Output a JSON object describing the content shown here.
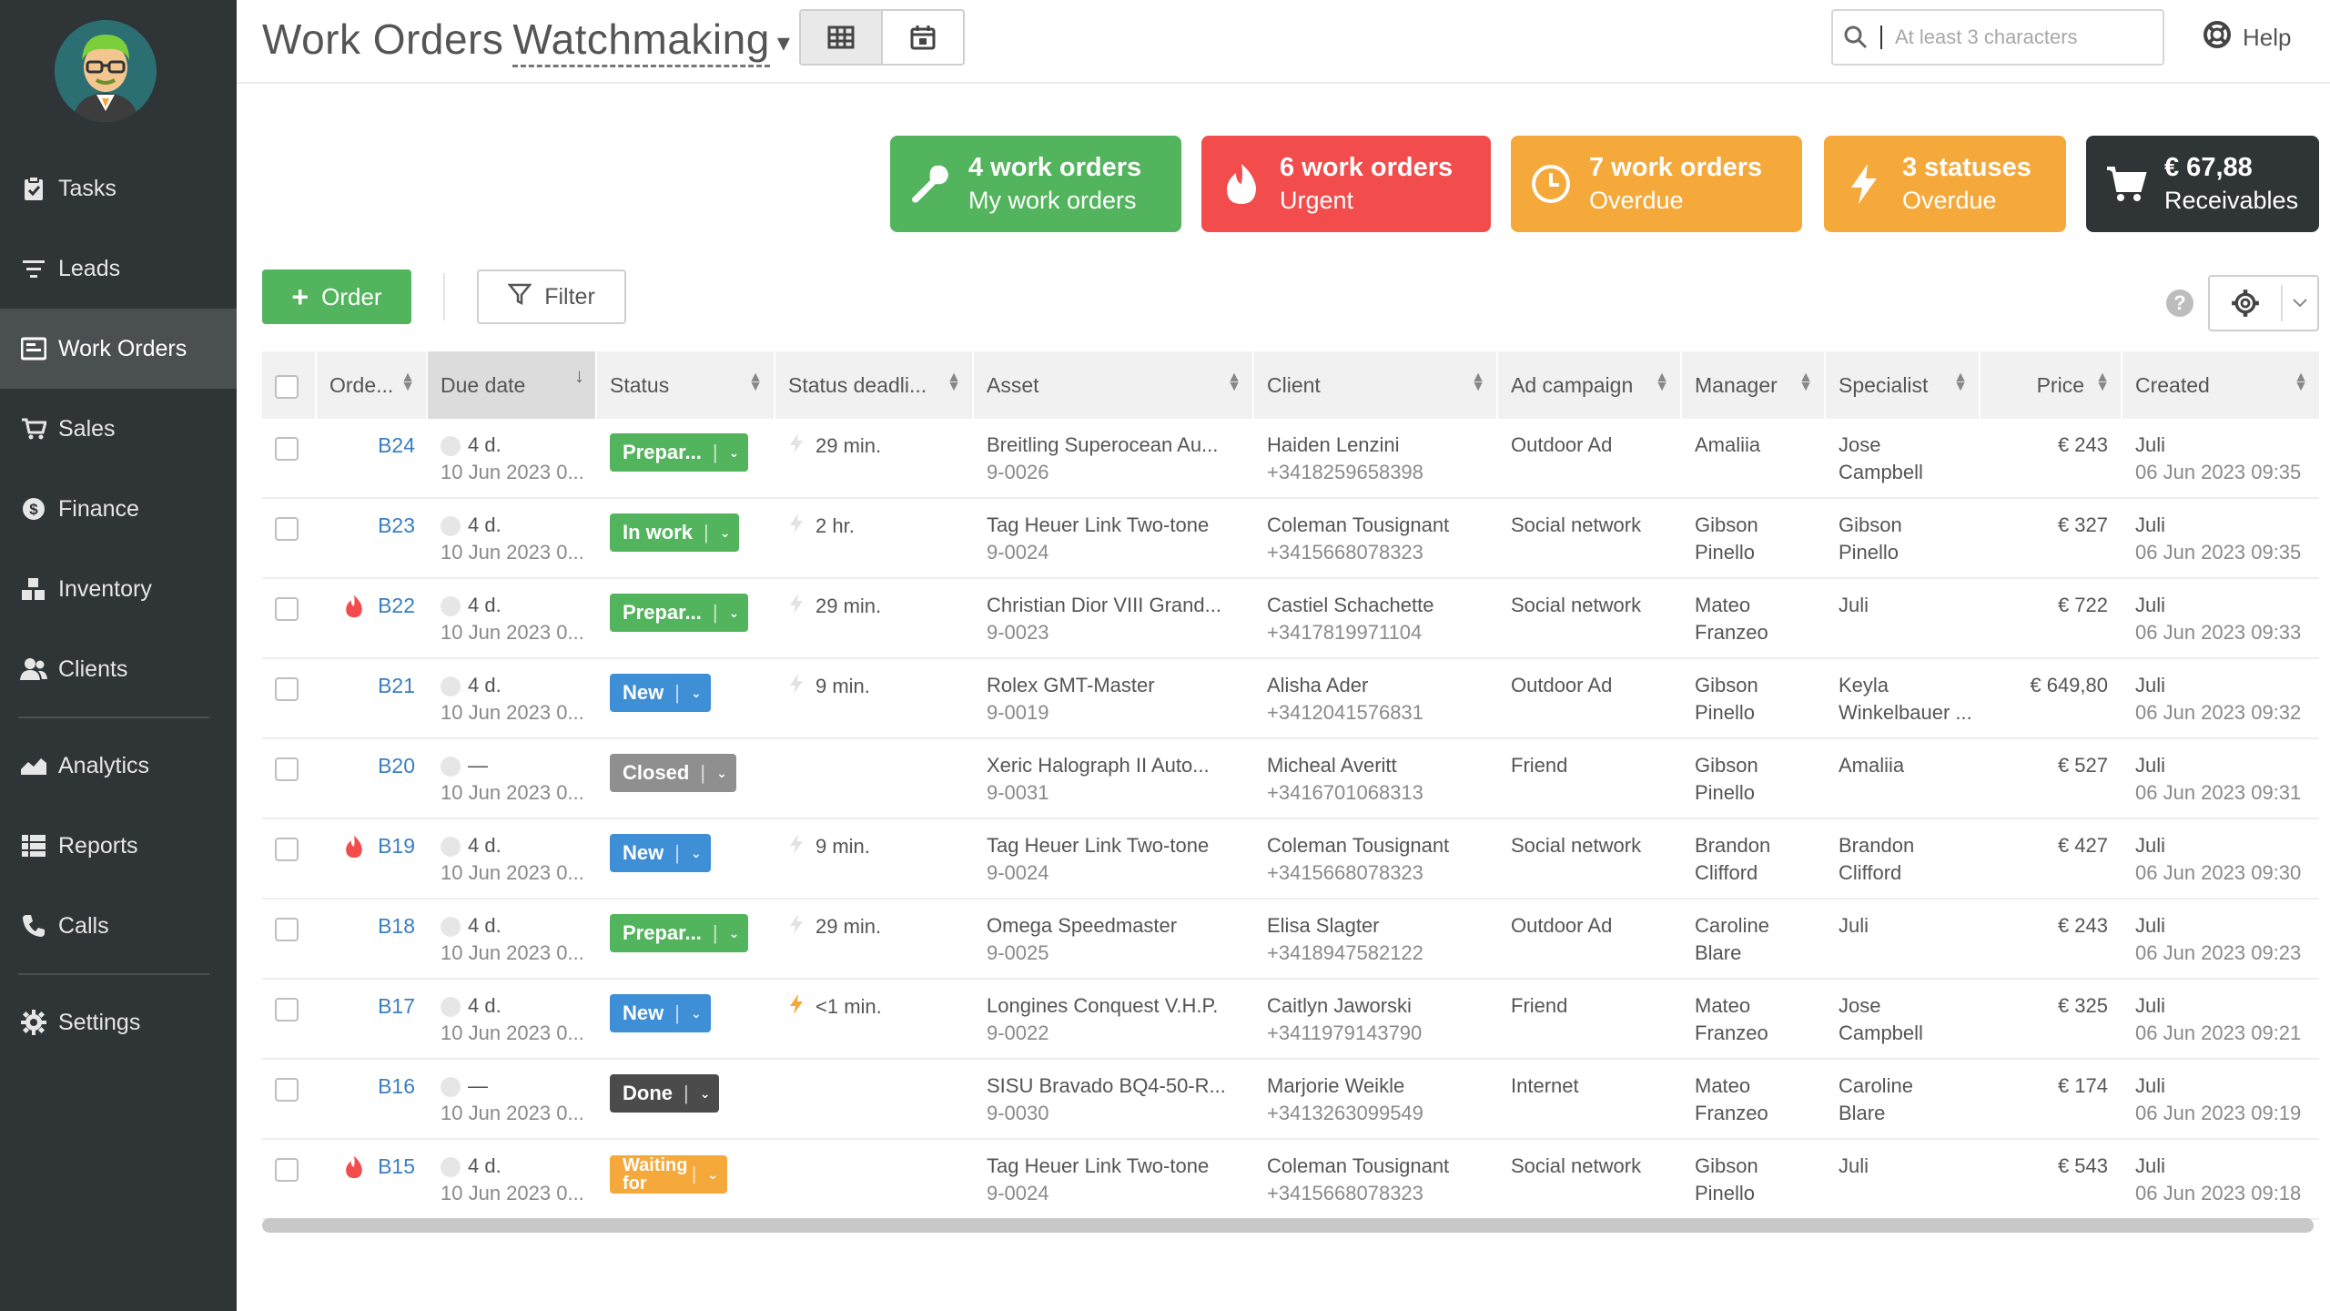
{
  "sidebar": {
    "items": [
      {
        "label": "Tasks",
        "icon": "clipboard-icon"
      },
      {
        "label": "Leads",
        "icon": "funnel-icon"
      },
      {
        "label": "Work Orders",
        "icon": "work-orders-icon",
        "active": true
      },
      {
        "label": "Sales",
        "icon": "cart-icon"
      },
      {
        "label": "Finance",
        "icon": "dollar-icon"
      },
      {
        "label": "Inventory",
        "icon": "boxes-icon"
      },
      {
        "label": "Clients",
        "icon": "users-icon"
      },
      {
        "label": "Analytics",
        "icon": "chart-icon"
      },
      {
        "label": "Reports",
        "icon": "table-icon"
      },
      {
        "label": "Calls",
        "icon": "phone-icon"
      },
      {
        "label": "Settings",
        "icon": "gear-icon"
      }
    ]
  },
  "header": {
    "title": "Work Orders",
    "selector": "Watchmaking",
    "search_placeholder": "At least 3 characters",
    "help_label": "Help"
  },
  "stats": [
    {
      "line1": "4 work orders",
      "line2": "My work orders",
      "color": "#52b45c",
      "icon": "wrench-icon"
    },
    {
      "line1": "6 work orders",
      "line2": "Urgent",
      "color": "#f24c4c",
      "icon": "flame-icon"
    },
    {
      "line1": "7 work orders",
      "line2": "Overdue",
      "color": "#f5a93a",
      "icon": "clock-icon"
    },
    {
      "line1": "3 statuses",
      "line2": "Overdue",
      "color": "#f5a93a",
      "icon": "bolt-icon"
    },
    {
      "line1": "€ 67,88",
      "line2": "Receivables",
      "color": "#2f3437",
      "icon": "cart-icon"
    }
  ],
  "toolbar": {
    "order_label": "Order",
    "filter_label": "Filter"
  },
  "table": {
    "columns": [
      "Orde...",
      "Due date",
      "Status",
      "Status deadli...",
      "Asset",
      "Client",
      "Ad campaign",
      "Manager",
      "Specialist",
      "Price",
      "Created"
    ],
    "rows": [
      {
        "order": "B24",
        "urgent": false,
        "due1": "4 d.",
        "due2": "10 Jun 2023 0...",
        "status": "Prepar...",
        "status_color": "green",
        "deadline": "29 min.",
        "bolt_active": false,
        "asset1": "Breitling Superocean Au...",
        "asset2": "9-0026",
        "client1": "Haiden Lenzini",
        "client2": "+3418259658398",
        "ad": "Outdoor Ad",
        "manager1": "Amaliia",
        "manager2": "",
        "spec1": "Jose",
        "spec2": "Campbell",
        "price": "€ 243",
        "created1": "Juli",
        "created2": "06 Jun 2023 09:35"
      },
      {
        "order": "B23",
        "urgent": false,
        "due1": "4 d.",
        "due2": "10 Jun 2023 0...",
        "status": "In work",
        "status_color": "green",
        "deadline": "2 hr.",
        "bolt_active": false,
        "asset1": "Tag Heuer Link Two-tone",
        "asset2": "9-0024",
        "client1": "Coleman Tousignant",
        "client2": "+3415668078323",
        "ad": "Social network",
        "manager1": "Gibson",
        "manager2": "Pinello",
        "spec1": "Gibson",
        "spec2": "Pinello",
        "price": "€ 327",
        "created1": "Juli",
        "created2": "06 Jun 2023 09:35"
      },
      {
        "order": "B22",
        "urgent": true,
        "due1": "4 d.",
        "due2": "10 Jun 2023 0...",
        "status": "Prepar...",
        "status_color": "green",
        "deadline": "29 min.",
        "bolt_active": false,
        "asset1": "Christian Dior VIII Grand...",
        "asset2": "9-0023",
        "client1": "Castiel Schachette",
        "client2": "+3417819971104",
        "ad": "Social network",
        "manager1": "Mateo",
        "manager2": "Franzeo",
        "spec1": "Juli",
        "spec2": "",
        "price": "€ 722",
        "created1": "Juli",
        "created2": "06 Jun 2023 09:33"
      },
      {
        "order": "B21",
        "urgent": false,
        "due1": "4 d.",
        "due2": "10 Jun 2023 0...",
        "status": "New",
        "status_color": "blue",
        "deadline": "9 min.",
        "bolt_active": false,
        "asset1": "Rolex GMT-Master",
        "asset2": "9-0019",
        "client1": "Alisha Ader",
        "client2": "+3412041576831",
        "ad": "Outdoor Ad",
        "manager1": "Gibson",
        "manager2": "Pinello",
        "spec1": "Keyla",
        "spec2": "Winkelbauer ...",
        "price": "€ 649,80",
        "created1": "Juli",
        "created2": "06 Jun 2023 09:32"
      },
      {
        "order": "B20",
        "urgent": false,
        "due1": "—",
        "due2": "10 Jun 2023 0...",
        "status": "Closed",
        "status_color": "grey",
        "deadline": "",
        "bolt_active": false,
        "asset1": "Xeric Halograph II Auto...",
        "asset2": "9-0031",
        "client1": "Micheal Averitt",
        "client2": "+3416701068313",
        "ad": "Friend",
        "manager1": "Gibson",
        "manager2": "Pinello",
        "spec1": "Amaliia",
        "spec2": "",
        "price": "€ 527",
        "created1": "Juli",
        "created2": "06 Jun 2023 09:31"
      },
      {
        "order": "B19",
        "urgent": true,
        "due1": "4 d.",
        "due2": "10 Jun 2023 0...",
        "status": "New",
        "status_color": "blue",
        "deadline": "9 min.",
        "bolt_active": false,
        "asset1": "Tag Heuer Link Two-tone",
        "asset2": "9-0024",
        "client1": "Coleman Tousignant",
        "client2": "+3415668078323",
        "ad": "Social network",
        "manager1": "Brandon",
        "manager2": "Clifford",
        "spec1": "Brandon",
        "spec2": "Clifford",
        "price": "€ 427",
        "created1": "Juli",
        "created2": "06 Jun 2023 09:30"
      },
      {
        "order": "B18",
        "urgent": false,
        "due1": "4 d.",
        "due2": "10 Jun 2023 0...",
        "status": "Prepar...",
        "status_color": "green",
        "deadline": "29 min.",
        "bolt_active": false,
        "asset1": "Omega Speedmaster",
        "asset2": "9-0025",
        "client1": "Elisa Slagter",
        "client2": "+3418947582122",
        "ad": "Outdoor Ad",
        "manager1": "Caroline",
        "manager2": "Blare",
        "spec1": "Juli",
        "spec2": "",
        "price": "€ 243",
        "created1": "Juli",
        "created2": "06 Jun 2023 09:23"
      },
      {
        "order": "B17",
        "urgent": false,
        "due1": "4 d.",
        "due2": "10 Jun 2023 0...",
        "status": "New",
        "status_color": "blue",
        "deadline": "<1 min.",
        "bolt_active": true,
        "asset1": "Longines Conquest V.H.P.",
        "asset2": "9-0022",
        "client1": "Caitlyn Jaworski",
        "client2": "+3411979143790",
        "ad": "Friend",
        "manager1": "Mateo",
        "manager2": "Franzeo",
        "spec1": "Jose",
        "spec2": "Campbell",
        "price": "€ 325",
        "created1": "Juli",
        "created2": "06 Jun 2023 09:21"
      },
      {
        "order": "B16",
        "urgent": false,
        "due1": "—",
        "due2": "10 Jun 2023 0...",
        "status": "Done",
        "status_color": "dark",
        "deadline": "",
        "bolt_active": false,
        "asset1": "SISU Bravado BQ4-50-R...",
        "asset2": "9-0030",
        "client1": "Marjorie Weikle",
        "client2": "+3413263099549",
        "ad": "Internet",
        "manager1": "Mateo",
        "manager2": "Franzeo",
        "spec1": "Caroline",
        "spec2": "Blare",
        "price": "€ 174",
        "created1": "Juli",
        "created2": "06 Jun 2023 09:19"
      },
      {
        "order": "B15",
        "urgent": true,
        "due1": "4 d.",
        "due2": "10 Jun 2023 0...",
        "status": "Waiting for",
        "status_color": "orange",
        "deadline": "",
        "bolt_active": false,
        "asset1": "Tag Heuer Link Two-tone",
        "asset2": "9-0024",
        "client1": "Coleman Tousignant",
        "client2": "+3415668078323",
        "ad": "Social network",
        "manager1": "Gibson",
        "manager2": "Pinello",
        "spec1": "Juli",
        "spec2": "",
        "price": "€ 543",
        "created1": "Juli",
        "created2": "06 Jun 2023 09:18"
      }
    ]
  }
}
